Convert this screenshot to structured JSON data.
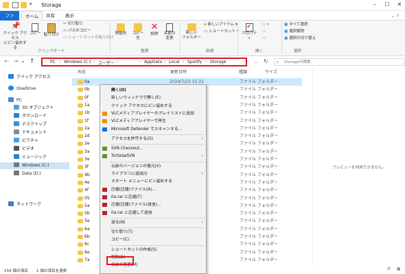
{
  "window": {
    "title": "Storage"
  },
  "tabs": [
    "ファイル",
    "ホーム",
    "共有",
    "表示"
  ],
  "ribbon": {
    "pin_label": "クイック アクセス\nにピン留めする",
    "copy_label": "コピー",
    "paste_label": "貼り付け",
    "cut_label": "切り取り",
    "copy_path_label": "パスのコピー",
    "paste_shortcut_label": "ショートカットの貼り付け",
    "clipboard_group": "クリップボード",
    "move_label": "移動先",
    "copyto_label": "コピー先",
    "delete_label": "削除",
    "rename_label": "名前の\n変更",
    "organize_group": "整理",
    "new_folder_label": "新しい\nフォルダー",
    "new_item_label": "新しいアイテム",
    "shortcut_label": "ショートカット",
    "new_group": "新規",
    "properties_label": "プロパティ",
    "open_group": "開く",
    "select_all_label": "すべて選択",
    "select_none_label": "選択解除",
    "invert_label": "選択の切り替え",
    "select_group": "選択"
  },
  "address": {
    "crumbs": [
      "PC",
      "Windows (C:)",
      "ユーザー",
      "AppData",
      "Local",
      "Spotify",
      "Storage"
    ],
    "search_placeholder": "Storageの検索"
  },
  "sidebar": {
    "items": [
      {
        "label": "クイック アクセス",
        "color": "#2b7de1"
      },
      {
        "label": "OneDrive",
        "color": "#1e88e5"
      },
      {
        "label": "PC",
        "color": "#3c8dd9"
      },
      {
        "label": "3D オブジェクト",
        "color": "#4aa3e0"
      },
      {
        "label": "ダウンロード",
        "color": "#2f80d0"
      },
      {
        "label": "デスクトップ",
        "color": "#3a8fd8"
      },
      {
        "label": "ドキュメント",
        "color": "#7f8c8d"
      },
      {
        "label": "ピクチャ",
        "color": "#4aa3e0"
      },
      {
        "label": "ビデオ",
        "color": "#555"
      },
      {
        "label": "ミュージック",
        "color": "#2f80d0"
      },
      {
        "label": "Windows (C:)",
        "color": "#777"
      },
      {
        "label": "Data (D:)",
        "color": "#777"
      },
      {
        "label": "ネットワーク",
        "color": "#3a7fc8"
      }
    ]
  },
  "columns": {
    "name": "名前",
    "date": "更新日時",
    "type": "種類",
    "size": "サイズ"
  },
  "files": [
    {
      "name": "0a",
      "date": "2024/7/23 15:21",
      "type": "ファイル フォルダー"
    },
    {
      "name": "0b",
      "date": "",
      "type": "ファイル フォルダー"
    },
    {
      "name": "0f",
      "date": "",
      "type": "ファイル フォルダー"
    },
    {
      "name": "1a",
      "date": "",
      "type": "ファイル フォルダー"
    },
    {
      "name": "1b",
      "date": "",
      "type": "ファイル フォルダー"
    },
    {
      "name": "1f",
      "date": "",
      "type": "ファイル フォルダー"
    },
    {
      "name": "2a",
      "date": "",
      "type": "ファイル フォルダー"
    },
    {
      "name": "2d",
      "date": "",
      "type": "ファイル フォルダー"
    },
    {
      "name": "2e",
      "date": "",
      "type": "ファイル フォルダー"
    },
    {
      "name": "3a",
      "date": "",
      "type": "ファイル フォルダー"
    },
    {
      "name": "3e",
      "date": "",
      "type": "ファイル フォルダー"
    },
    {
      "name": "3f",
      "date": "",
      "type": "ファイル フォルダー"
    },
    {
      "name": "4b",
      "date": "",
      "type": "ファイル フォルダー"
    },
    {
      "name": "4e",
      "date": "",
      "type": "ファイル フォルダー"
    },
    {
      "name": "4f",
      "date": "",
      "type": "ファイル フォルダー"
    },
    {
      "name": "05",
      "date": "",
      "type": "ファイル フォルダー"
    },
    {
      "name": "5a",
      "date": "",
      "type": "ファイル フォルダー"
    },
    {
      "name": "5b",
      "date": "",
      "type": "ファイル フォルダー"
    },
    {
      "name": "5e",
      "date": "",
      "type": "ファイル フォルダー"
    },
    {
      "name": "6a",
      "date": "",
      "type": "ファイル フォルダー"
    },
    {
      "name": "6b",
      "date": "",
      "type": "ファイル フォルダー"
    },
    {
      "name": "6c",
      "date": "",
      "type": "ファイル フォルダー"
    },
    {
      "name": "6e",
      "date": "",
      "type": "ファイル フォルダー"
    },
    {
      "name": "7a",
      "date": "",
      "type": "ファイル フォルダー"
    }
  ],
  "preview_text": "プレビューを利用できません。",
  "status": {
    "count": "158 個の項目",
    "selected": "1 個の項目を選択"
  },
  "context_menu": [
    {
      "label": "開く(O)",
      "bold": true
    },
    {
      "label": "新しいウィンドウで開く(E)"
    },
    {
      "label": "クイック アクセスにピン留めする"
    },
    {
      "label": "VLCメディアプレイヤーのプレイリストに追加",
      "icon": "vlc"
    },
    {
      "label": "VLCメディアプレイヤーで再生",
      "icon": "vlc"
    },
    {
      "label": "Microsoft Defender でスキャンする...",
      "icon": "defender"
    },
    {
      "sep": true
    },
    {
      "label": "アクセスを許可する(G)",
      "arrow": true
    },
    {
      "sep": true
    },
    {
      "label": "SVN Checkout...",
      "icon": "svn"
    },
    {
      "label": "TortoiseSVN",
      "icon": "svn",
      "arrow": true
    },
    {
      "sep": true
    },
    {
      "label": "以前のバージョンの復元(V)"
    },
    {
      "label": "ライブラリに追加(I)",
      "arrow": true
    },
    {
      "label": "スタート メニューにピン留めする"
    },
    {
      "label": "圧縮(圧縮)ファイル(A)...",
      "icon": "rar"
    },
    {
      "label": "0a.rar に圧縮(T)",
      "icon": "rar"
    },
    {
      "label": "圧縮(圧縮)ファイル(送信)...",
      "icon": "rar"
    },
    {
      "label": "0a.rar に圧縮して送信",
      "icon": "rar"
    },
    {
      "sep": true
    },
    {
      "label": "送る(N)",
      "arrow": true
    },
    {
      "sep": true
    },
    {
      "label": "切り取り(T)"
    },
    {
      "label": "コピー(C)"
    },
    {
      "sep": true
    },
    {
      "label": "ショートカットの作成(S)"
    },
    {
      "label": "削除(D)"
    },
    {
      "label": "名前の変更(M)"
    }
  ],
  "colors": {
    "accent": "#1c6dd0",
    "highlight": "#e0141e",
    "folder": "#f6c64a",
    "selection": "#cce8ff"
  }
}
